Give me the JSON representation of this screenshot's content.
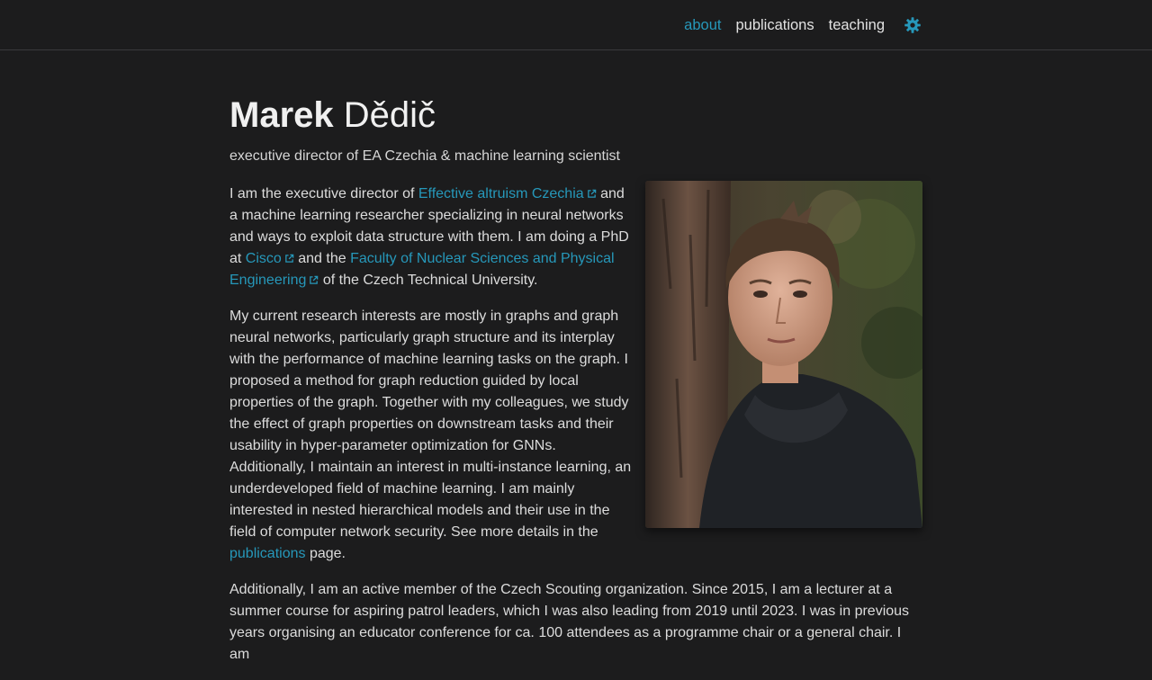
{
  "nav": {
    "about": "about",
    "publications": "publications",
    "teaching": "teaching",
    "theme_icon": "gear-icon"
  },
  "header": {
    "first_name": "Marek",
    "last_name": "Dědič",
    "description": "executive director of EA Czechia & machine learning scientist"
  },
  "bio": {
    "p1": {
      "t1": "I am the executive director of ",
      "link1": "Effective altruism Czechia",
      "t2": " and a machine learning researcher specializing in neural networks and ways to exploit data structure with them. I am doing a PhD at ",
      "link2": "Cisco",
      "t3": " and the ",
      "link3": "Faculty of Nuclear Sciences and Physical Engineering",
      "t4": " of the Czech Technical University."
    },
    "p2": {
      "t1": "My current research interests are mostly in graphs and graph neural networks, particularly graph structure and its interplay with the performance of machine learning tasks on the graph. I proposed a method for graph reduction guided by local properties of the graph. Together with my colleagues, we study the effect of graph properties on downstream tasks and their usability in hyper-parameter optimization for GNNs. Additionally, I maintain an interest in multi-instance learning, an underdeveloped field of machine learning. I am mainly interested in nested hierarchical models and their use in the field of computer network security. See more details in the ",
      "link1": "publications",
      "t2": " page."
    },
    "p3": "Additionally, I am an active member of the Czech Scouting organization. Since 2015, I am a lecturer at a summer course for aspiring patrol leaders, which I was also leading from 2019 until 2023. I was in previous years organising an educator conference for ca. 100 attendees as a programme chair or a general chair. I am"
  },
  "colors": {
    "background": "#1c1c1d",
    "accent": "#2698ba",
    "text": "#dcdcdc"
  }
}
